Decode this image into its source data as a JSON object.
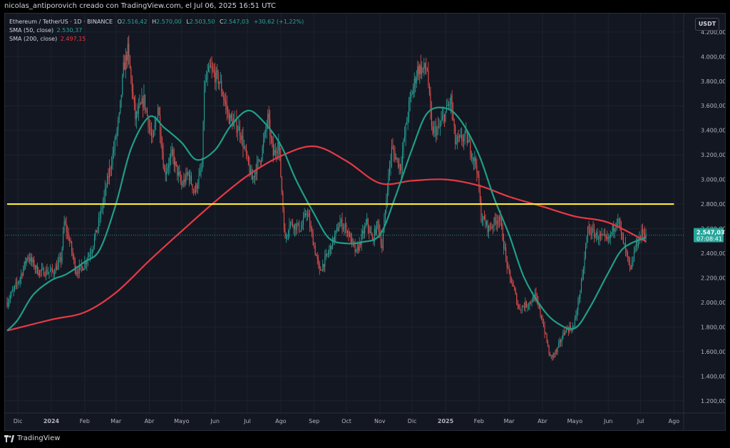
{
  "header": {
    "attribution": "nicolas_antiporovich creado con TradingView.com, el Jul 06, 2025 16:51 UTC"
  },
  "legend": {
    "symbol": "Ethereum / TetherUS · 1D · BINANCE",
    "open_label": "O",
    "open": "2.516,42",
    "high_label": "H",
    "high": "2.570,00",
    "low_label": "L",
    "low": "2.503,50",
    "close_label": "C",
    "close": "2.547,03",
    "change": "+30,62 (+1,22%)",
    "sma50_label": "SMA (50, close)",
    "sma50_value": "2.530,37",
    "sma200_label": "SMA (200, close)",
    "sma200_value": "2.497,15"
  },
  "currency_button": "USDT",
  "footer": {
    "brand": "TradingView"
  },
  "colors": {
    "background": "#131722",
    "up": "#26a69a",
    "down": "#ef5350",
    "sma50": "#1f9e89",
    "sma200": "#e53945",
    "hline": "#ffeb3b"
  },
  "chart_data": {
    "type": "candlestick",
    "symbol": "Ethereum / TetherUS",
    "interval": "1D",
    "exchange": "BINANCE",
    "ylim": [
      1100,
      4350
    ],
    "y_ticks": [
      {
        "value": 4200,
        "label": "4.200,00"
      },
      {
        "value": 4000,
        "label": "4.000,00"
      },
      {
        "value": 3800,
        "label": "3.800,00"
      },
      {
        "value": 3600,
        "label": "3.600,00"
      },
      {
        "value": 3400,
        "label": "3.400,00"
      },
      {
        "value": 3200,
        "label": "3.200,00"
      },
      {
        "value": 3000,
        "label": "3.000,00"
      },
      {
        "value": 2800,
        "label": "2.800,00"
      },
      {
        "value": 2600,
        "label": "2.600,00"
      },
      {
        "value": 2400,
        "label": "2.400,00"
      },
      {
        "value": 2200,
        "label": "2.200,00"
      },
      {
        "value": 2000,
        "label": "2.000,00"
      },
      {
        "value": 1800,
        "label": "1.800,00"
      },
      {
        "value": 1600,
        "label": "1.600,00"
      },
      {
        "value": 1400,
        "label": "1.400,00"
      },
      {
        "value": 1200,
        "label": "1.200,00"
      }
    ],
    "x_ticks": [
      {
        "date": "2023-12-01",
        "label": "Dic"
      },
      {
        "date": "2024-01-01",
        "label": "2024"
      },
      {
        "date": "2024-02-01",
        "label": "Feb"
      },
      {
        "date": "2024-03-01",
        "label": "Mar"
      },
      {
        "date": "2024-04-01",
        "label": "Abr"
      },
      {
        "date": "2024-05-01",
        "label": "Mayo"
      },
      {
        "date": "2024-06-01",
        "label": "Jun"
      },
      {
        "date": "2024-07-01",
        "label": "Jul"
      },
      {
        "date": "2024-08-01",
        "label": "Ago"
      },
      {
        "date": "2024-09-01",
        "label": "Sep"
      },
      {
        "date": "2024-10-01",
        "label": "Oct"
      },
      {
        "date": "2024-11-01",
        "label": "Nov"
      },
      {
        "date": "2024-12-01",
        "label": "Dic"
      },
      {
        "date": "2025-01-01",
        "label": "2025"
      },
      {
        "date": "2025-02-01",
        "label": "Feb"
      },
      {
        "date": "2025-03-01",
        "label": "Mar"
      },
      {
        "date": "2025-04-01",
        "label": "Abr"
      },
      {
        "date": "2025-05-01",
        "label": "Mayo"
      },
      {
        "date": "2025-06-01",
        "label": "Jun"
      },
      {
        "date": "2025-07-01",
        "label": "Jul"
      },
      {
        "date": "2025-08-01",
        "label": "Ago"
      }
    ],
    "price_anchors": [
      [
        "2023-11-21",
        2000
      ],
      [
        "2023-12-03",
        2200
      ],
      [
        "2023-12-10",
        2380
      ],
      [
        "2023-12-20",
        2250
      ],
      [
        "2024-01-03",
        2250
      ],
      [
        "2024-01-10",
        2350
      ],
      [
        "2024-01-13",
        2650
      ],
      [
        "2024-01-18",
        2500
      ],
      [
        "2024-01-24",
        2250
      ],
      [
        "2024-01-31",
        2300
      ],
      [
        "2024-02-08",
        2450
      ],
      [
        "2024-02-14",
        2650
      ],
      [
        "2024-02-20",
        2900
      ],
      [
        "2024-02-27",
        3200
      ],
      [
        "2024-03-04",
        3500
      ],
      [
        "2024-03-08",
        3900
      ],
      [
        "2024-03-12",
        4050
      ],
      [
        "2024-03-19",
        3500
      ],
      [
        "2024-03-27",
        3650
      ],
      [
        "2024-04-04",
        3300
      ],
      [
        "2024-04-09",
        3600
      ],
      [
        "2024-04-15",
        3050
      ],
      [
        "2024-04-22",
        3200
      ],
      [
        "2024-05-01",
        2950
      ],
      [
        "2024-05-07",
        3050
      ],
      [
        "2024-05-13",
        2900
      ],
      [
        "2024-05-20",
        3100
      ],
      [
        "2024-05-22",
        3750
      ],
      [
        "2024-05-27",
        3900
      ],
      [
        "2024-06-05",
        3800
      ],
      [
        "2024-06-14",
        3500
      ],
      [
        "2024-06-24",
        3400
      ],
      [
        "2024-07-05",
        3000
      ],
      [
        "2024-07-14",
        3200
      ],
      [
        "2024-07-20",
        3500
      ],
      [
        "2024-07-25",
        3200
      ],
      [
        "2024-07-30",
        3300
      ],
      [
        "2024-08-05",
        2500
      ],
      [
        "2024-08-09",
        2650
      ],
      [
        "2024-08-20",
        2600
      ],
      [
        "2024-08-25",
        2750
      ],
      [
        "2024-09-06",
        2250
      ],
      [
        "2024-09-14",
        2400
      ],
      [
        "2024-09-25",
        2650
      ],
      [
        "2024-10-01",
        2600
      ],
      [
        "2024-10-10",
        2400
      ],
      [
        "2024-10-14",
        2500
      ],
      [
        "2024-10-20",
        2650
      ],
      [
        "2024-10-25",
        2500
      ],
      [
        "2024-10-30",
        2650
      ],
      [
        "2024-11-03",
        2450
      ],
      [
        "2024-11-08",
        2950
      ],
      [
        "2024-11-12",
        3250
      ],
      [
        "2024-11-20",
        3100
      ],
      [
        "2024-11-28",
        3600
      ],
      [
        "2024-12-06",
        3900
      ],
      [
        "2024-12-15",
        3900
      ],
      [
        "2024-12-19",
        3400
      ],
      [
        "2024-12-25",
        3400
      ],
      [
        "2025-01-06",
        3650
      ],
      [
        "2025-01-10",
        3300
      ],
      [
        "2025-01-20",
        3350
      ],
      [
        "2025-01-30",
        3100
      ],
      [
        "2025-02-03",
        2700
      ],
      [
        "2025-02-10",
        2600
      ],
      [
        "2025-02-20",
        2700
      ],
      [
        "2025-02-28",
        2250
      ],
      [
        "2025-03-04",
        2150
      ],
      [
        "2025-03-10",
        1950
      ],
      [
        "2025-03-20",
        2000
      ],
      [
        "2025-03-25",
        2050
      ],
      [
        "2025-04-01",
        1850
      ],
      [
        "2025-04-08",
        1550
      ],
      [
        "2025-04-14",
        1600
      ],
      [
        "2025-04-22",
        1780
      ],
      [
        "2025-04-30",
        1800
      ],
      [
        "2025-05-08",
        2200
      ],
      [
        "2025-05-13",
        2600
      ],
      [
        "2025-05-20",
        2550
      ],
      [
        "2025-06-01",
        2500
      ],
      [
        "2025-06-10",
        2700
      ],
      [
        "2025-06-13",
        2550
      ],
      [
        "2025-06-22",
        2250
      ],
      [
        "2025-06-26",
        2450
      ],
      [
        "2025-07-03",
        2580
      ],
      [
        "2025-07-06",
        2547
      ]
    ],
    "sma50": [
      [
        "2023-11-21",
        1770
      ],
      [
        "2023-12-01",
        1860
      ],
      [
        "2023-12-15",
        2060
      ],
      [
        "2024-01-01",
        2180
      ],
      [
        "2024-01-15",
        2230
      ],
      [
        "2024-02-01",
        2330
      ],
      [
        "2024-02-15",
        2430
      ],
      [
        "2024-03-01",
        2800
      ],
      [
        "2024-03-15",
        3250
      ],
      [
        "2024-04-01",
        3510
      ],
      [
        "2024-04-15",
        3420
      ],
      [
        "2024-05-01",
        3300
      ],
      [
        "2024-05-15",
        3160
      ],
      [
        "2024-06-01",
        3240
      ],
      [
        "2024-06-15",
        3430
      ],
      [
        "2024-07-01",
        3560
      ],
      [
        "2024-07-15",
        3480
      ],
      [
        "2024-08-01",
        3280
      ],
      [
        "2024-08-15",
        3000
      ],
      [
        "2024-09-01",
        2720
      ],
      [
        "2024-09-15",
        2520
      ],
      [
        "2024-10-01",
        2480
      ],
      [
        "2024-10-15",
        2490
      ],
      [
        "2024-11-01",
        2550
      ],
      [
        "2024-11-15",
        2850
      ],
      [
        "2024-12-01",
        3250
      ],
      [
        "2024-12-15",
        3540
      ],
      [
        "2025-01-01",
        3580
      ],
      [
        "2025-01-15",
        3480
      ],
      [
        "2025-02-01",
        3200
      ],
      [
        "2025-02-15",
        2850
      ],
      [
        "2025-03-01",
        2550
      ],
      [
        "2025-03-15",
        2200
      ],
      [
        "2025-04-01",
        1950
      ],
      [
        "2025-04-15",
        1830
      ],
      [
        "2025-05-01",
        1790
      ],
      [
        "2025-05-15",
        1960
      ],
      [
        "2025-06-01",
        2240
      ],
      [
        "2025-06-15",
        2440
      ],
      [
        "2025-07-06",
        2530
      ]
    ],
    "sma200": [
      [
        "2023-11-21",
        1770
      ],
      [
        "2024-01-01",
        1860
      ],
      [
        "2024-02-01",
        1920
      ],
      [
        "2024-03-01",
        2080
      ],
      [
        "2024-04-01",
        2340
      ],
      [
        "2024-05-01",
        2580
      ],
      [
        "2024-06-01",
        2820
      ],
      [
        "2024-07-01",
        3030
      ],
      [
        "2024-08-01",
        3190
      ],
      [
        "2024-09-01",
        3270
      ],
      [
        "2024-10-01",
        3150
      ],
      [
        "2024-11-01",
        2970
      ],
      [
        "2024-12-01",
        2990
      ],
      [
        "2025-01-01",
        3000
      ],
      [
        "2025-02-01",
        2950
      ],
      [
        "2025-03-01",
        2860
      ],
      [
        "2025-04-01",
        2780
      ],
      [
        "2025-05-01",
        2700
      ],
      [
        "2025-06-01",
        2650
      ],
      [
        "2025-07-06",
        2497
      ]
    ],
    "horizontal_line": {
      "value": 2800,
      "from": "2023-11-21",
      "to": "2025-08-01"
    },
    "last_price": {
      "value": 2547,
      "label": "2.547,03",
      "countdown": "07:08:41"
    },
    "x_range": [
      "2023-11-19",
      "2025-08-10"
    ]
  }
}
